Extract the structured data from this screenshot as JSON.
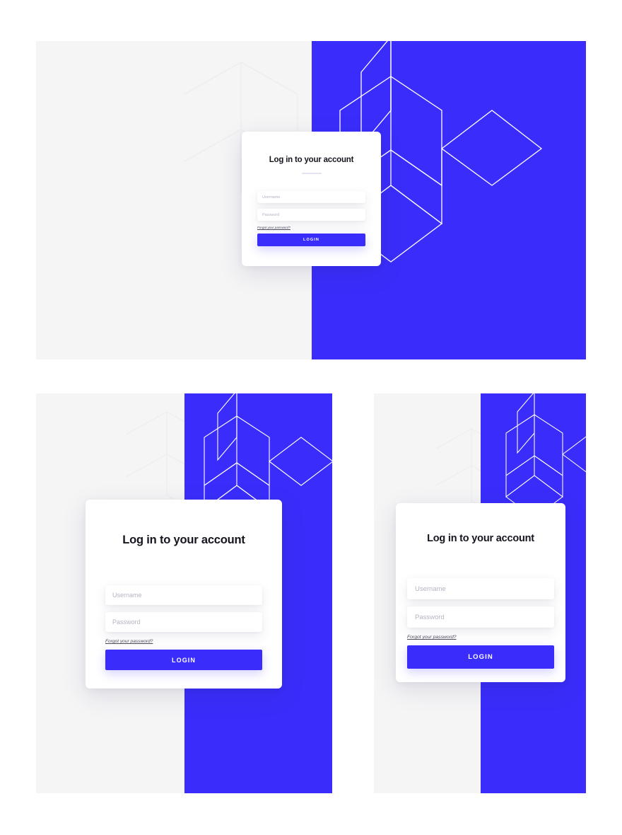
{
  "theme": {
    "accent_blue": "#3a2dfb",
    "panel_light": "#f5f5f6",
    "card_white": "#ffffff",
    "title_color": "#15151f",
    "placeholder_color": "#b4b4c4",
    "pattern_line_light": "#ededf1",
    "pattern_line_blue": "#ffffff"
  },
  "login": {
    "title": "Log in to your account",
    "username": {
      "value": "",
      "placeholder": "Username"
    },
    "password": {
      "value": "",
      "placeholder": "Password"
    },
    "forgot_link": "Forgot your password?",
    "submit_label": "LOGIN"
  },
  "mockups": [
    {
      "id": "main",
      "name": "desktop-login-screen"
    },
    {
      "id": "left",
      "name": "tablet-login-screen"
    },
    {
      "id": "right",
      "name": "mobile-login-screen"
    }
  ]
}
